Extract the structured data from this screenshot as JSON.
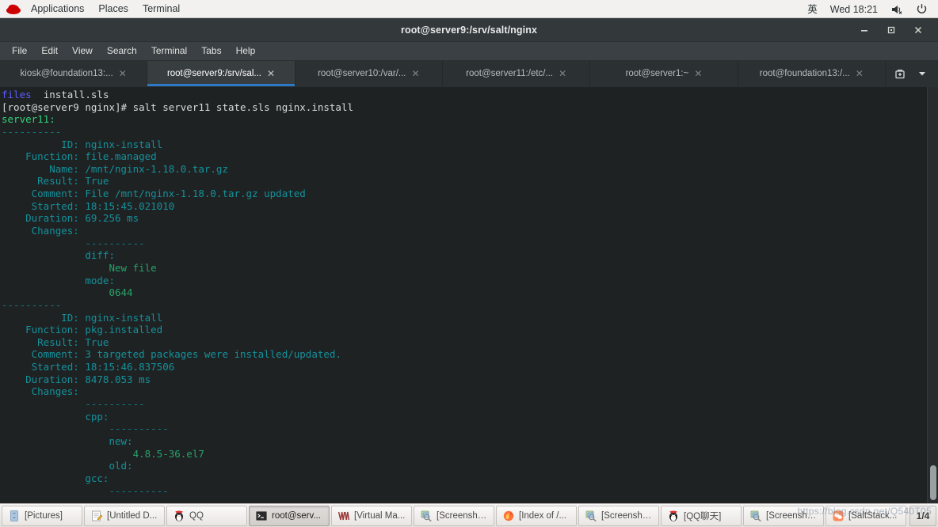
{
  "panel": {
    "logo_icon": "redhat-logo-icon",
    "menus": [
      "Applications",
      "Places",
      "Terminal"
    ],
    "input_method": "英",
    "clock": "Wed 18:21",
    "volume_icon": "volume-muted-icon",
    "power_icon": "power-icon"
  },
  "window": {
    "title": "root@server9:/srv/salt/nginx",
    "minimize_icon": "minimize-icon",
    "maximize_icon": "maximize-icon",
    "close_icon": "close-icon"
  },
  "menubar": [
    "File",
    "Edit",
    "View",
    "Search",
    "Terminal",
    "Tabs",
    "Help"
  ],
  "tabs": {
    "items": [
      {
        "label": "kiosk@foundation13:...",
        "active": false
      },
      {
        "label": "root@server9:/srv/sal...",
        "active": true
      },
      {
        "label": "root@server10:/var/...",
        "active": false
      },
      {
        "label": "root@server11:/etc/...",
        "active": false
      },
      {
        "label": "root@server1:~",
        "active": false
      },
      {
        "label": "root@foundation13:/...",
        "active": false
      }
    ],
    "close_icon": "close-icon",
    "new_tab_icon": "new-tab-icon",
    "list_icon": "chevron-down-icon",
    "active_underline_color": "#2d79c7"
  },
  "terminal": {
    "lines": [
      [
        {
          "t": "files",
          "c": "c-blue"
        },
        {
          "t": "  install.sls",
          "c": "c-white"
        }
      ],
      [
        {
          "t": "[root@server9 nginx]# salt server11 state.sls nginx.install",
          "c": "c-white"
        }
      ],
      [
        {
          "t": "server11:",
          "c": "c-bgreen"
        }
      ],
      [
        {
          "t": "----------",
          "c": "c-dash"
        }
      ],
      [
        {
          "t": "          ID: ",
          "c": "c-key"
        },
        {
          "t": "nginx-install",
          "c": "c-val"
        }
      ],
      [
        {
          "t": "    Function: ",
          "c": "c-key"
        },
        {
          "t": "file.managed",
          "c": "c-val"
        }
      ],
      [
        {
          "t": "        Name: ",
          "c": "c-key"
        },
        {
          "t": "/mnt/nginx-1.18.0.tar.gz",
          "c": "c-val"
        }
      ],
      [
        {
          "t": "      Result: ",
          "c": "c-key"
        },
        {
          "t": "True",
          "c": "c-val"
        }
      ],
      [
        {
          "t": "     Comment: ",
          "c": "c-key"
        },
        {
          "t": "File /mnt/nginx-1.18.0.tar.gz updated",
          "c": "c-val"
        }
      ],
      [
        {
          "t": "     Started: ",
          "c": "c-key"
        },
        {
          "t": "18:15:45.021010",
          "c": "c-val"
        }
      ],
      [
        {
          "t": "    Duration: ",
          "c": "c-key"
        },
        {
          "t": "69.256 ms",
          "c": "c-val"
        }
      ],
      [
        {
          "t": "     Changes: ",
          "c": "c-key"
        }
      ],
      [
        {
          "t": "              ----------",
          "c": "c-dash"
        }
      ],
      [
        {
          "t": "              diff:",
          "c": "c-key"
        }
      ],
      [
        {
          "t": "                  New file",
          "c": "c-green"
        }
      ],
      [
        {
          "t": "              mode:",
          "c": "c-key"
        }
      ],
      [
        {
          "t": "                  0644",
          "c": "c-green"
        }
      ],
      [
        {
          "t": "----------",
          "c": "c-dash"
        }
      ],
      [
        {
          "t": "          ID: ",
          "c": "c-key"
        },
        {
          "t": "nginx-install",
          "c": "c-val"
        }
      ],
      [
        {
          "t": "    Function: ",
          "c": "c-key"
        },
        {
          "t": "pkg.installed",
          "c": "c-val"
        }
      ],
      [
        {
          "t": "      Result: ",
          "c": "c-key"
        },
        {
          "t": "True",
          "c": "c-val"
        }
      ],
      [
        {
          "t": "     Comment: ",
          "c": "c-key"
        },
        {
          "t": "3 targeted packages were installed/updated.",
          "c": "c-val"
        }
      ],
      [
        {
          "t": "     Started: ",
          "c": "c-key"
        },
        {
          "t": "18:15:46.837506",
          "c": "c-val"
        }
      ],
      [
        {
          "t": "    Duration: ",
          "c": "c-key"
        },
        {
          "t": "8478.053 ms",
          "c": "c-val"
        }
      ],
      [
        {
          "t": "     Changes: ",
          "c": "c-key"
        }
      ],
      [
        {
          "t": "              ----------",
          "c": "c-dash"
        }
      ],
      [
        {
          "t": "              cpp:",
          "c": "c-key"
        }
      ],
      [
        {
          "t": "                  ----------",
          "c": "c-dash"
        }
      ],
      [
        {
          "t": "                  new:",
          "c": "c-key"
        }
      ],
      [
        {
          "t": "                      4.8.5-36.el7",
          "c": "c-green"
        }
      ],
      [
        {
          "t": "                  old:",
          "c": "c-key"
        }
      ],
      [
        {
          "t": "              gcc:",
          "c": "c-key"
        }
      ],
      [
        {
          "t": "                  ----------",
          "c": "c-dash"
        }
      ]
    ]
  },
  "taskbar": {
    "items": [
      {
        "label": "[Pictures]",
        "icon": "file-manager-icon",
        "active": false
      },
      {
        "label": "[Untitled D...",
        "icon": "text-editor-icon",
        "active": false
      },
      {
        "label": "QQ",
        "icon": "qq-penguin-icon",
        "active": false
      },
      {
        "label": "root@serv...",
        "icon": "terminal-icon",
        "active": true
      },
      {
        "label": "[Virtual Ma...",
        "icon": "virtual-machine-icon",
        "active": false
      },
      {
        "label": "[Screensho...",
        "icon": "screenshot-icon",
        "active": false
      },
      {
        "label": "[Index of /...",
        "icon": "firefox-icon",
        "active": false
      },
      {
        "label": "[Screensho...",
        "icon": "screenshot-icon",
        "active": false
      },
      {
        "label": "[QQ聊天]",
        "icon": "qq-penguin-icon",
        "active": false
      },
      {
        "label": "[Screensho...",
        "icon": "screenshot-icon",
        "active": false
      },
      {
        "label": "[SaltStack...",
        "icon": "wechat-icon",
        "active": false
      }
    ],
    "pager": "1/4"
  },
  "watermark": "https://blog.csdn.net/Q540T05"
}
